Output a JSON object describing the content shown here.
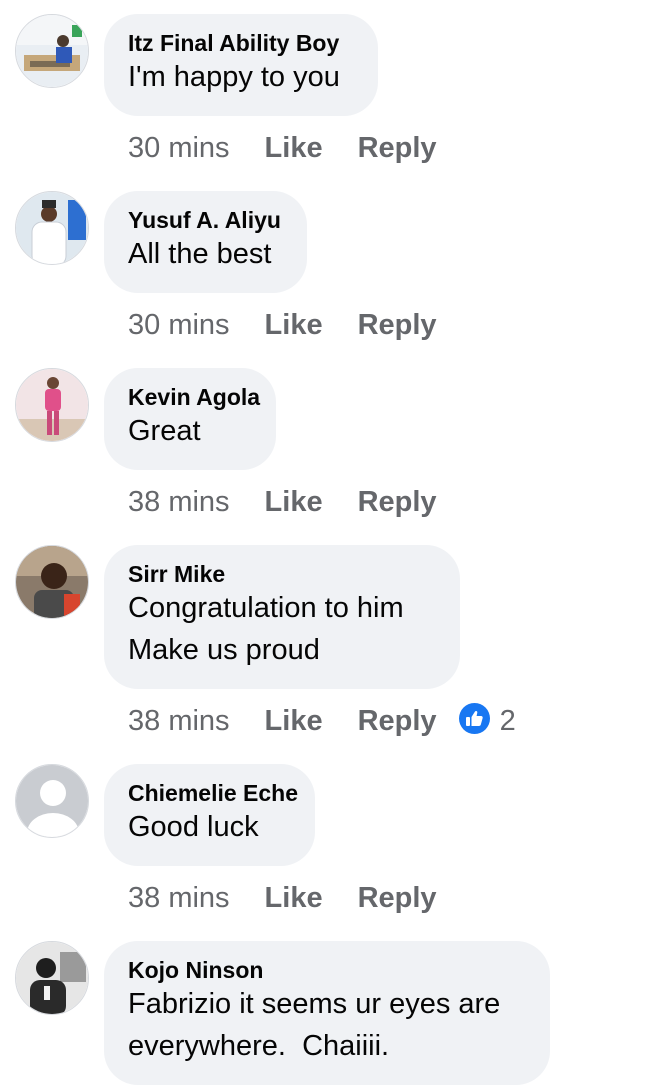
{
  "comments": [
    {
      "author": "Itz Final Ability Boy",
      "text": [
        "I'm happy to you"
      ],
      "time": "30 mins",
      "like_label": "Like",
      "reply_label": "Reply"
    },
    {
      "author": "Yusuf A. Aliyu",
      "text": [
        "All the best"
      ],
      "time": "30 mins",
      "like_label": "Like",
      "reply_label": "Reply"
    },
    {
      "author": "Kevin Agola",
      "text": [
        "Great"
      ],
      "time": "38 mins",
      "like_label": "Like",
      "reply_label": "Reply"
    },
    {
      "author": "Sirr Mike",
      "text": [
        "Congratulation to him",
        "Make us proud"
      ],
      "time": "38 mins",
      "like_label": "Like",
      "reply_label": "Reply",
      "reaction": {
        "icon": "thumbs-up-icon",
        "count": "2",
        "color": "#1877f2"
      }
    },
    {
      "author": "Chiemelie Eche",
      "text": [
        "Good luck"
      ],
      "time": "38 mins",
      "like_label": "Like",
      "reply_label": "Reply"
    },
    {
      "author": "Kojo Ninson",
      "text": [
        "Fabrizio it seems ur eyes are",
        "everywhere.  Chaiiii."
      ]
    }
  ],
  "colors": {
    "bubble_bg": "#f0f2f5",
    "meta_text": "#65676b",
    "name_text": "#050505",
    "accent": "#1877f2"
  }
}
